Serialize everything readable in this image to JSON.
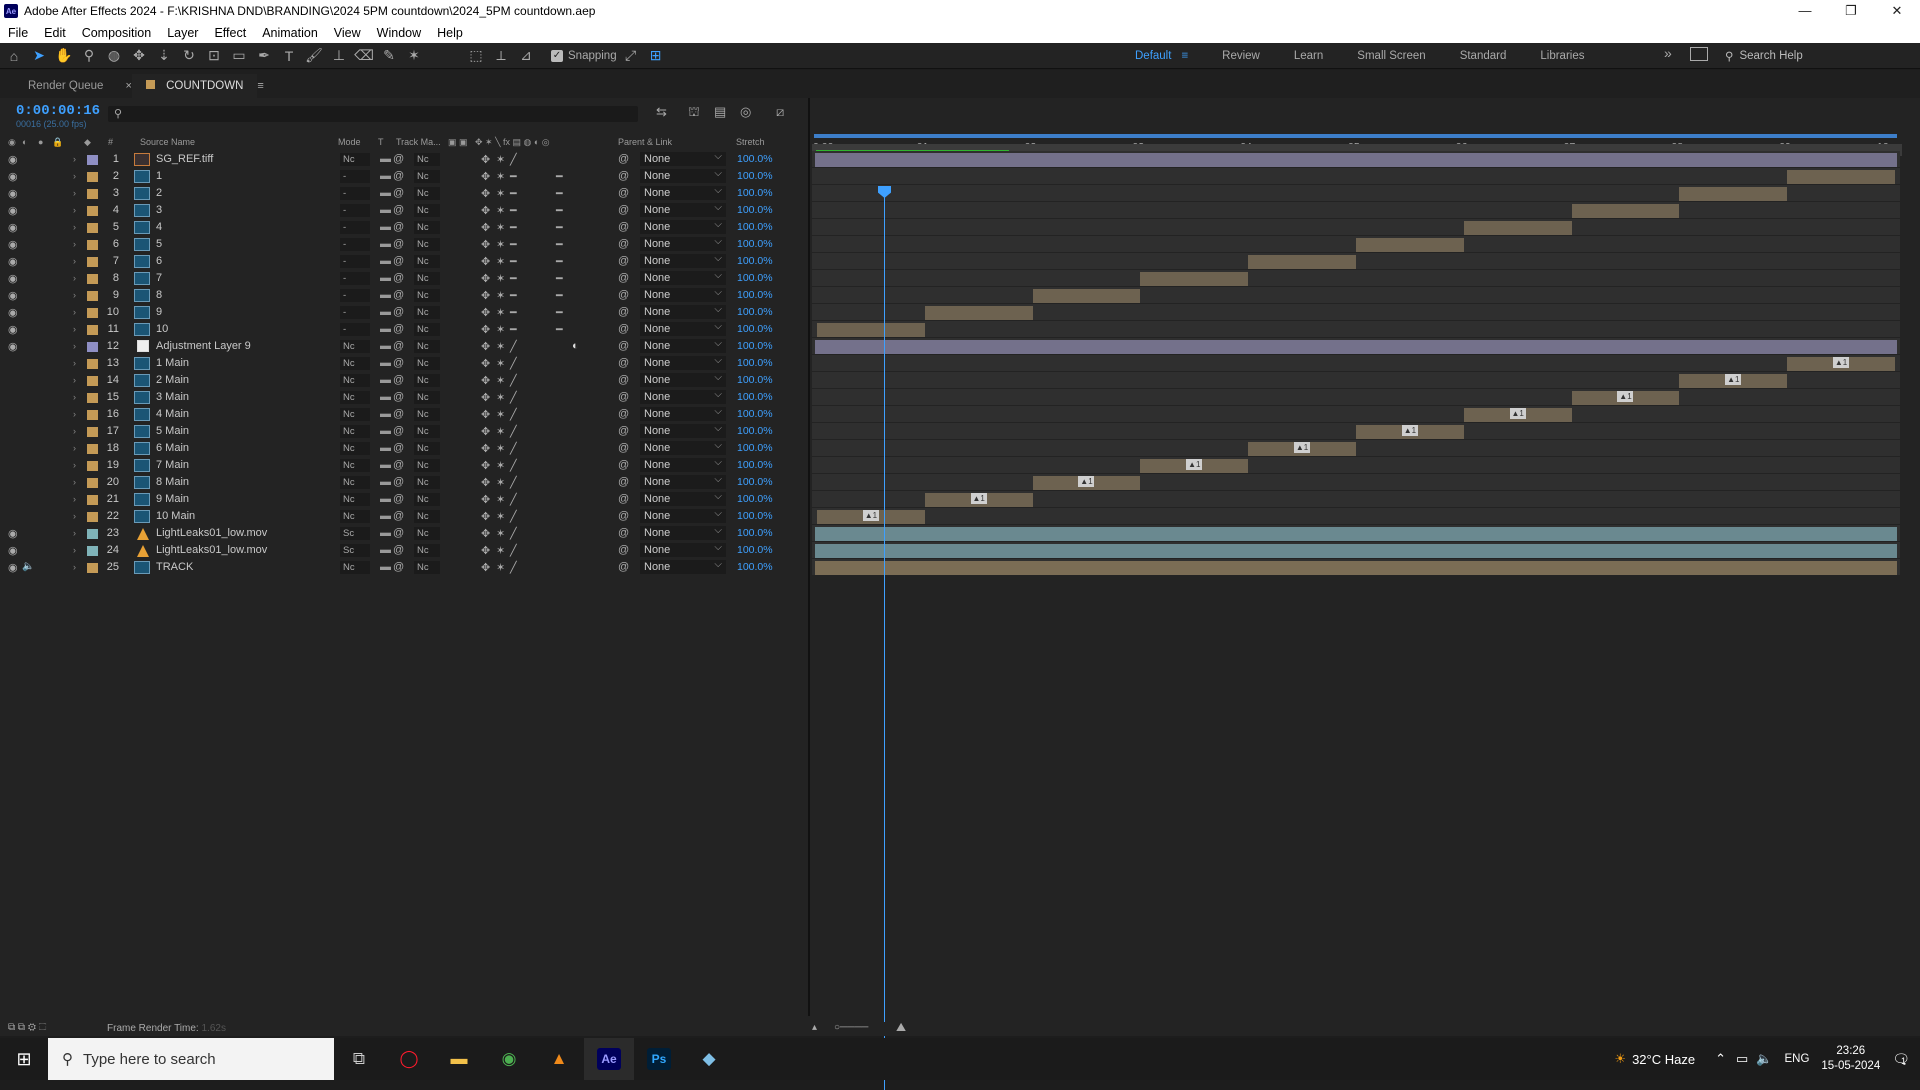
{
  "window": {
    "title": "Adobe After Effects 2024 - F:\\KRISHNA DND\\BRANDING\\2024 5PM countdown\\2024_5PM countdown.aep",
    "logo": "Ae"
  },
  "menu": [
    "File",
    "Edit",
    "Composition",
    "Layer",
    "Effect",
    "Animation",
    "View",
    "Window",
    "Help"
  ],
  "toolbar": {
    "snapping": "Snapping",
    "workspaces": [
      "Default",
      "Review",
      "Learn",
      "Small Screen",
      "Standard",
      "Libraries"
    ],
    "search_help": "Search Help"
  },
  "tabs": {
    "render_queue": "Render Queue",
    "close": "×",
    "composition": "COUNTDOWN",
    "menu": "≡"
  },
  "timeline": {
    "timecode": "0:00:00:16",
    "fps": "00016 (25.00 fps)",
    "headers": {
      "source_name": "Source Name",
      "mode": "Mode",
      "t": "T",
      "track_matte": "Track Ma...",
      "parent_link": "Parent & Link",
      "stretch": "Stretch",
      "num": "#"
    },
    "ruler": [
      "0:00s",
      "01s",
      "02s",
      "03s",
      "04s",
      "05s",
      "06s",
      "07s",
      "08s",
      "09s",
      "10s"
    ]
  },
  "layers": [
    {
      "num": "1",
      "name": "SG_REF.tiff",
      "mode": "Nc",
      "tm": "Nc",
      "parent": "None",
      "stretch": "100.0%",
      "label": "#8f8fc4",
      "icon": "img",
      "eye": true
    },
    {
      "num": "2",
      "name": "1",
      "mode": "-",
      "tm": "Nc",
      "parent": "None",
      "stretch": "100.0%",
      "label": "#c49a56",
      "icon": "comp",
      "eye": true
    },
    {
      "num": "3",
      "name": "2",
      "mode": "-",
      "tm": "Nc",
      "parent": "None",
      "stretch": "100.0%",
      "label": "#c49a56",
      "icon": "comp",
      "eye": true
    },
    {
      "num": "4",
      "name": "3",
      "mode": "-",
      "tm": "Nc",
      "parent": "None",
      "stretch": "100.0%",
      "label": "#c49a56",
      "icon": "comp",
      "eye": true
    },
    {
      "num": "5",
      "name": "4",
      "mode": "-",
      "tm": "Nc",
      "parent": "None",
      "stretch": "100.0%",
      "label": "#c49a56",
      "icon": "comp",
      "eye": true
    },
    {
      "num": "6",
      "name": "5",
      "mode": "-",
      "tm": "Nc",
      "parent": "None",
      "stretch": "100.0%",
      "label": "#c49a56",
      "icon": "comp",
      "eye": true
    },
    {
      "num": "7",
      "name": "6",
      "mode": "-",
      "tm": "Nc",
      "parent": "None",
      "stretch": "100.0%",
      "label": "#c49a56",
      "icon": "comp",
      "eye": true
    },
    {
      "num": "8",
      "name": "7",
      "mode": "-",
      "tm": "Nc",
      "parent": "None",
      "stretch": "100.0%",
      "label": "#c49a56",
      "icon": "comp",
      "eye": true
    },
    {
      "num": "9",
      "name": "8",
      "mode": "-",
      "tm": "Nc",
      "parent": "None",
      "stretch": "100.0%",
      "label": "#c49a56",
      "icon": "comp",
      "eye": true
    },
    {
      "num": "10",
      "name": "9",
      "mode": "-",
      "tm": "Nc",
      "parent": "None",
      "stretch": "100.0%",
      "label": "#c49a56",
      "icon": "comp",
      "eye": true
    },
    {
      "num": "11",
      "name": "10",
      "mode": "-",
      "tm": "Nc",
      "parent": "None",
      "stretch": "100.0%",
      "label": "#c49a56",
      "icon": "comp",
      "eye": true
    },
    {
      "num": "12",
      "name": "Adjustment Layer 9",
      "mode": "Nc",
      "tm": "Nc",
      "parent": "None",
      "stretch": "100.0%",
      "label": "#8f8fc4",
      "icon": "adj",
      "eye": true
    },
    {
      "num": "13",
      "name": "1 Main",
      "mode": "Nc",
      "tm": "Nc",
      "parent": "None",
      "stretch": "100.0%",
      "label": "#c49a56",
      "icon": "comp",
      "eye": false
    },
    {
      "num": "14",
      "name": "2 Main",
      "mode": "Nc",
      "tm": "Nc",
      "parent": "None",
      "stretch": "100.0%",
      "label": "#c49a56",
      "icon": "comp",
      "eye": false
    },
    {
      "num": "15",
      "name": "3 Main",
      "mode": "Nc",
      "tm": "Nc",
      "parent": "None",
      "stretch": "100.0%",
      "label": "#c49a56",
      "icon": "comp",
      "eye": false
    },
    {
      "num": "16",
      "name": "4 Main",
      "mode": "Nc",
      "tm": "Nc",
      "parent": "None",
      "stretch": "100.0%",
      "label": "#c49a56",
      "icon": "comp",
      "eye": false
    },
    {
      "num": "17",
      "name": "5 Main",
      "mode": "Nc",
      "tm": "Nc",
      "parent": "None",
      "stretch": "100.0%",
      "label": "#c49a56",
      "icon": "comp",
      "eye": false
    },
    {
      "num": "18",
      "name": "6 Main",
      "mode": "Nc",
      "tm": "Nc",
      "parent": "None",
      "stretch": "100.0%",
      "label": "#c49a56",
      "icon": "comp",
      "eye": false
    },
    {
      "num": "19",
      "name": "7 Main",
      "mode": "Nc",
      "tm": "Nc",
      "parent": "None",
      "stretch": "100.0%",
      "label": "#c49a56",
      "icon": "comp",
      "eye": false
    },
    {
      "num": "20",
      "name": "8 Main",
      "mode": "Nc",
      "tm": "Nc",
      "parent": "None",
      "stretch": "100.0%",
      "label": "#c49a56",
      "icon": "comp",
      "eye": false
    },
    {
      "num": "21",
      "name": "9 Main",
      "mode": "Nc",
      "tm": "Nc",
      "parent": "None",
      "stretch": "100.0%",
      "label": "#c49a56",
      "icon": "comp",
      "eye": false
    },
    {
      "num": "22",
      "name": "10 Main",
      "mode": "Nc",
      "tm": "Nc",
      "parent": "None",
      "stretch": "100.0%",
      "label": "#c49a56",
      "icon": "comp",
      "eye": false
    },
    {
      "num": "23",
      "name": "LightLeaks01_low.mov",
      "mode": "Sc",
      "tm": "Nc",
      "parent": "None",
      "stretch": "100.0%",
      "label": "#7fb3b8",
      "icon": "cone",
      "eye": true
    },
    {
      "num": "24",
      "name": "LightLeaks01_low.mov",
      "mode": "Sc",
      "tm": "Nc",
      "parent": "None",
      "stretch": "100.0%",
      "label": "#7fb3b8",
      "icon": "cone",
      "eye": true
    },
    {
      "num": "25",
      "name": "TRACK",
      "mode": "Nc",
      "tm": "Nc",
      "parent": "None",
      "stretch": "100.0%",
      "label": "#c49a56",
      "icon": "comp",
      "eye": true,
      "audio": true
    }
  ],
  "status": {
    "frame_render_label": "Frame Render Time:",
    "frame_render_value": "1.62s"
  },
  "taskbar": {
    "search_placeholder": "Type here to search",
    "weather": "32°C  Haze",
    "lang": "ENG",
    "time": "23:26",
    "date": "15-05-2024",
    "notif": "1"
  }
}
